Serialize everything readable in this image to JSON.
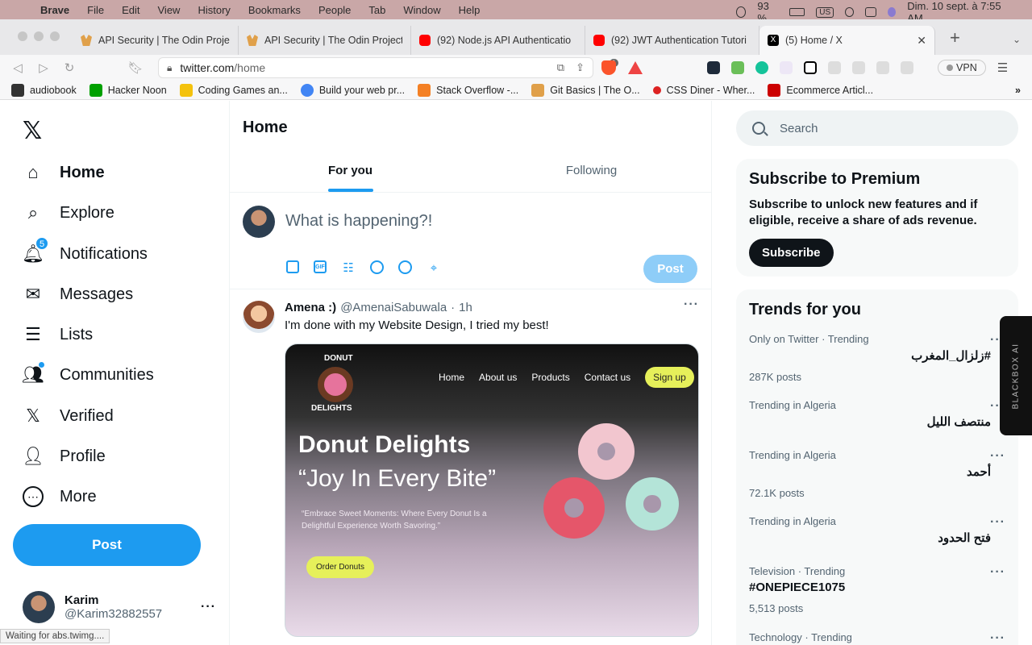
{
  "menubar": {
    "app": "Brave",
    "items": [
      "File",
      "Edit",
      "View",
      "History",
      "Bookmarks",
      "People",
      "Tab",
      "Window",
      "Help"
    ],
    "battery": "93 %",
    "kb": "US",
    "datetime": "Dim. 10 sept. à 7:55 AM"
  },
  "tabs": [
    {
      "title": "API Security | The Odin Project",
      "icon": "odin-icon"
    },
    {
      "title": "API Security | The Odin Project",
      "icon": "odin-icon"
    },
    {
      "title": "(92) Node.js API Authenticatio",
      "icon": "youtube-icon"
    },
    {
      "title": "(92) JWT Authentication Tutori",
      "icon": "youtube-icon"
    },
    {
      "title": "(5) Home / X",
      "icon": "x-icon",
      "close": "✕"
    }
  ],
  "address": {
    "host": "twitter.com",
    "path": "/home",
    "brave_count": "1",
    "vpn": "VPN"
  },
  "bookmarks": [
    {
      "label": "audiobook",
      "color": "#333333"
    },
    {
      "label": "Hacker Noon",
      "color": "#00a000"
    },
    {
      "label": "Coding Games an...",
      "color": "#f4c20d"
    },
    {
      "label": "Build your web pr...",
      "color": "#4285f4"
    },
    {
      "label": "Stack Overflow -...",
      "color": "#f48024"
    },
    {
      "label": "Git Basics | The O...",
      "color": "#e0a04a"
    },
    {
      "label": "CSS Diner - Wher...",
      "color": "#dd2222"
    },
    {
      "label": "Ecommerce Articl...",
      "color": "#cc0000"
    }
  ],
  "nav": {
    "logo": "𝕏",
    "items": [
      {
        "label": "Home",
        "icon": "home-icon",
        "glyph": "⌂"
      },
      {
        "label": "Explore",
        "icon": "search-icon",
        "glyph": "⌕"
      },
      {
        "label": "Notifications",
        "icon": "bell-icon",
        "glyph": "🔔︎",
        "badge": "5"
      },
      {
        "label": "Messages",
        "icon": "mail-icon",
        "glyph": "✉"
      },
      {
        "label": "Lists",
        "icon": "list-icon",
        "glyph": "☰"
      },
      {
        "label": "Communities",
        "icon": "people-icon",
        "glyph": "👥︎"
      },
      {
        "label": "Verified",
        "icon": "x-verified-icon",
        "glyph": "𝕏"
      },
      {
        "label": "Profile",
        "icon": "person-icon",
        "glyph": "👤︎"
      },
      {
        "label": "More",
        "icon": "more-circle-icon",
        "glyph": "⋯"
      }
    ],
    "post": "Post",
    "account": {
      "name": "Karim",
      "handle": "@Karim32882557",
      "more": "···"
    },
    "status": "Waiting for abs.twimg...."
  },
  "main": {
    "title": "Home",
    "tabs": [
      "For you",
      "Following"
    ],
    "compose_placeholder": "What is happening?!",
    "post": "Post",
    "tweet": {
      "name": "Amena :)",
      "handle": "@AmenaiSabuwala",
      "sep": "·",
      "time": "1h",
      "text": "I'm done with my Website Design, I tried my best!",
      "more": "···",
      "media": {
        "logo_top": "DONUT",
        "logo_bottom": "DELIGHTS",
        "nav": [
          "Home",
          "About us",
          "Products",
          "Contact us"
        ],
        "signup": "Sign up",
        "h1": "Donut Delights",
        "h2": "“Joy In Every Bite”",
        "p": "“Embrace Sweet Moments: Where Every Donut Is a Delightful Experience Worth Savoring.”",
        "order": "Order Donuts"
      }
    }
  },
  "right": {
    "search_placeholder": "Search",
    "premium": {
      "title": "Subscribe to Premium",
      "text": "Subscribe to unlock new features and if eligible, receive a share of ads revenue.",
      "button": "Subscribe"
    },
    "trends_title": "Trends for you",
    "trends": [
      {
        "context": "Only on Twitter · Trending",
        "topic": "#زلزال_المغرب",
        "count": "287K posts",
        "rtl": true
      },
      {
        "context": "Trending in Algeria",
        "topic": "منتصف الليل",
        "count": "",
        "rtl": true
      },
      {
        "context": "Trending in Algeria",
        "topic": "أحمد",
        "count": "72.1K posts",
        "rtl": true
      },
      {
        "context": "Trending in Algeria",
        "topic": "فتح الحدود",
        "count": "",
        "rtl": true
      },
      {
        "context": "Television · Trending",
        "topic": "#ONEPIECE1075",
        "count": "5,513 posts",
        "rtl": false
      },
      {
        "context": "Technology · Trending",
        "topic": "",
        "count": "",
        "rtl": false
      }
    ],
    "more": "···"
  },
  "blackbox": "BLACKBOX AI",
  "colors": {
    "accent": "#1d9bf0",
    "text": "#0f1419",
    "muted": "#536471"
  }
}
